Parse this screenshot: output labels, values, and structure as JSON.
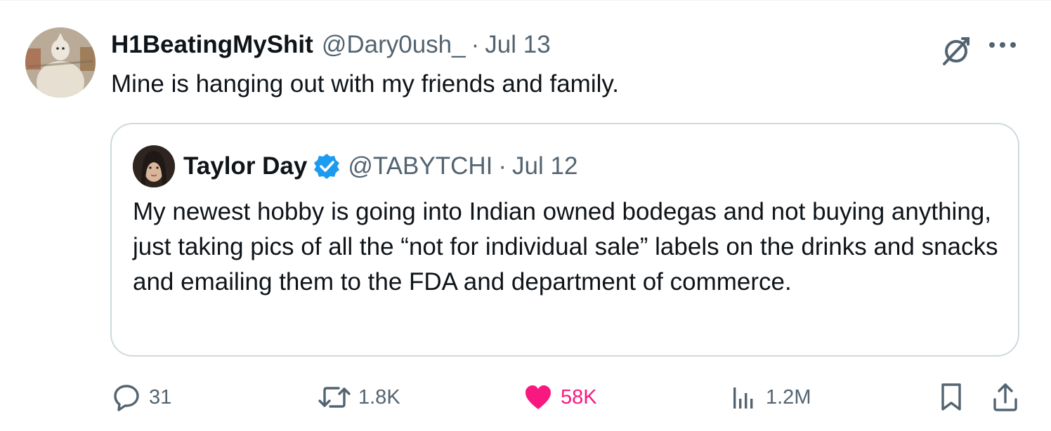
{
  "tweet": {
    "author": {
      "display_name": "H1BeatingMyShit",
      "handle": "@Dary0ush_",
      "separator": "·",
      "date": "Jul 13"
    },
    "text": "Mine is hanging out with my friends and family.",
    "header_icons": [
      "grok-icon",
      "more-icon"
    ]
  },
  "quote": {
    "author": {
      "display_name": "Taylor Day",
      "verified": true,
      "handle": "@TABYTCHI",
      "separator": "·",
      "date": "Jul 12"
    },
    "text": "My newest hobby is going into Indian owned bodegas and not buying anything, just taking pics of all the “not for individual sale” labels on the drinks and snacks and emailing them to the FDA and department of commerce."
  },
  "actions": {
    "replies": "31",
    "reposts": "1.8K",
    "likes": "58K",
    "views": "1.2M",
    "like_active": true
  },
  "colors": {
    "text_primary": "#0f1419",
    "text_secondary": "#536471",
    "border": "#cfd9de",
    "like_pink": "#f91880",
    "verified_blue": "#1d9bf0"
  }
}
